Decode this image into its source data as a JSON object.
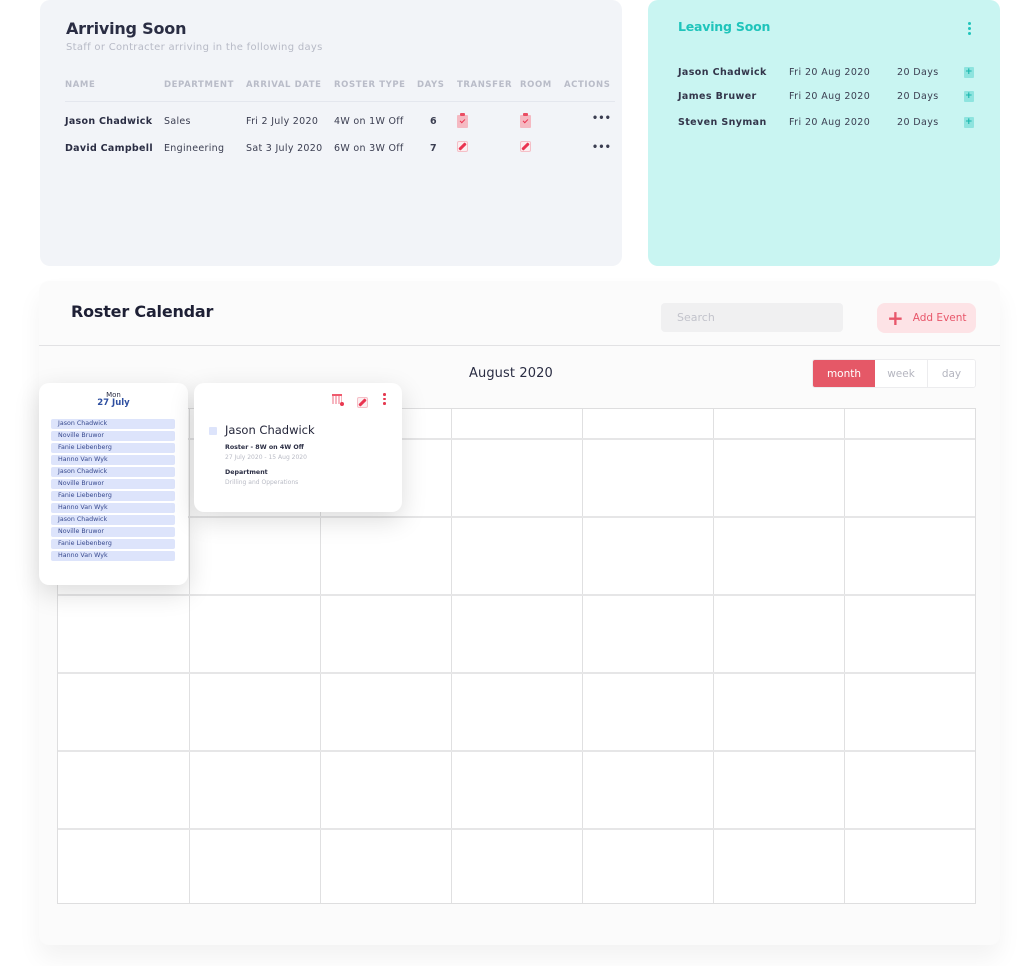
{
  "arriving": {
    "title": "Arriving Soon",
    "subtitle": "Staff or Contracter arriving in the following days",
    "columns": [
      "NAME",
      "DEPARTMENT",
      "ARRIVAL DATE",
      "ROSTER TYPE",
      "DAYS",
      "TRANSFER",
      "ROOM",
      "ACTIONS"
    ],
    "rows": [
      {
        "name": "Jason Chadwick",
        "department": "Sales",
        "arrival_date": "Fri 2 July 2020",
        "roster_type": "4W on 1W Off",
        "days": "6",
        "transfer_icon": "clipboard-check-icon",
        "room_icon": "clipboard-check-icon",
        "actions": "•••"
      },
      {
        "name": "David Campbell",
        "department": "Engineering",
        "arrival_date": "Sat 3 July 2020",
        "roster_type": "6W on 3W Off",
        "days": "7",
        "transfer_icon": "edit-icon",
        "room_icon": "edit-icon",
        "actions": "•••"
      }
    ]
  },
  "leaving": {
    "title": "Leaving Soon",
    "menu_icon": "kebab-icon",
    "rows": [
      {
        "name": "Jason Chadwick",
        "date": "Fri 20 Aug 2020",
        "days": "20 Days",
        "action_icon": "add-file-icon"
      },
      {
        "name": "James Bruwer",
        "date": "Fri 20 Aug 2020",
        "days": "20 Days",
        "action_icon": "add-file-icon"
      },
      {
        "name": "Steven Snyman",
        "date": "Fri 20 Aug 2020",
        "days": "20 Days",
        "action_icon": "add-file-icon"
      }
    ],
    "add_glyph": "+"
  },
  "roster": {
    "title": "Roster Calendar",
    "search_placeholder": "Search",
    "add_event_label": "Add Event",
    "add_event_glyph": "+",
    "month_title": "August 2020",
    "views": [
      "month",
      "week",
      "day"
    ],
    "active_view": "month"
  },
  "day_popup": {
    "day_of_week": "Mon",
    "date": "27 July",
    "entries": [
      "Jason Chadwick",
      "Noville Bruwor",
      "Fanie Liebenberg",
      "Hanno Van Wyk",
      "Jason Chadwick",
      "Noville Bruwor",
      "Fanie Liebenberg",
      "Hanno Van Wyk",
      "Jason Chadwick",
      "Noville Bruwor",
      "Fanie Liebenberg",
      "Hanno Van Wyk"
    ]
  },
  "event_popup": {
    "name": "Jason Chadwick",
    "roster": "Roster - 8W on 4W Off",
    "range": "27 July 2020 - 15 Aug 2020",
    "department_label": "Department",
    "department_value": "Drilling and Opperations"
  },
  "colors": {
    "accent_red": "#e55867",
    "accent_teal": "#1fc4bb",
    "leaving_bg": "#c9f5f2",
    "arriving_bg": "#f2f4f8"
  }
}
